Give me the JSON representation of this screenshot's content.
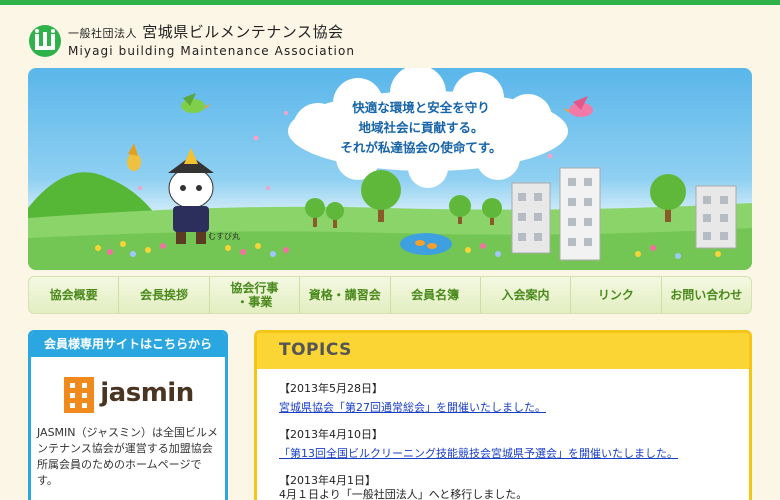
{
  "header": {
    "org_type": "一般社団法人",
    "org_name": "宮城県ビルメンテナンス協会",
    "org_name_en": "Miyagi building Maintenance Association"
  },
  "hero": {
    "tagline": [
      "快適な環境と安全を守り",
      "地域社会に貢献する。",
      "それが私達協会の使命てす。"
    ],
    "mascot_name": "むすび丸"
  },
  "nav": [
    {
      "label": "協会概要"
    },
    {
      "label": "会長挨拶"
    },
    {
      "label": "協会行事\n・事業"
    },
    {
      "label": "資格・講習会"
    },
    {
      "label": "会員名簿"
    },
    {
      "label": "入会案内"
    },
    {
      "label": "リンク"
    },
    {
      "label": "お問い合わせ"
    }
  ],
  "sidebar": {
    "heading": "会員様専用サイトはこちらから",
    "logo_text": "jasmin",
    "description": "JASMIN（ジャスミン）は全国ビルメンテナンス協会が運営する加盟協会所属会員のためのホームページです。"
  },
  "topics": {
    "heading": "TOPICS",
    "items": [
      {
        "date": "【2013年5月28日】",
        "text": "宮城県協会「第27回通常総会」を開催いたしました。",
        "link": true
      },
      {
        "date": "【2013年4月10日】",
        "text": "「第13回全国ビルクリーニング技能競技会宮城県予選会」を開催いたしました。",
        "link": true
      },
      {
        "date": "【2013年4月1日】",
        "text": "4月１日より「一般社団法人」へと移行しました。",
        "link": false
      }
    ]
  },
  "colors": {
    "brand_green": "#2fb24a",
    "nav_text": "#4a8a1c",
    "sidebar_blue": "#2aa7e0",
    "topics_yellow": "#fbd533",
    "link_blue": "#1a3fc7"
  }
}
